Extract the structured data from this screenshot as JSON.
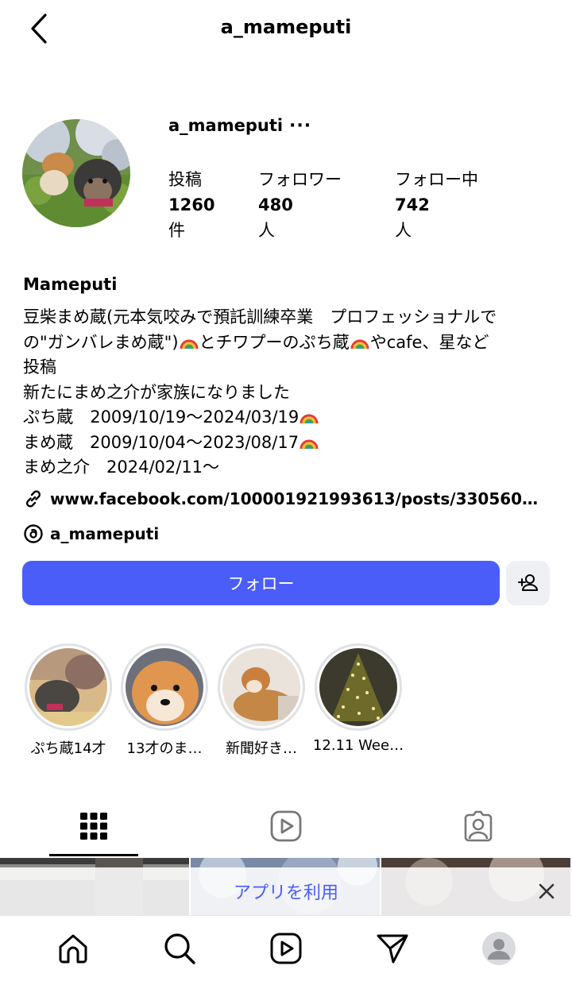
{
  "header": {
    "title": "a_mameputi"
  },
  "profile": {
    "username": "a_mameputi",
    "more_label": "···",
    "stats": [
      {
        "label": "投稿",
        "value": "1260",
        "unit": "件"
      },
      {
        "label": "フォロワー",
        "value": "480",
        "unit": "人"
      },
      {
        "label": "フォロー中",
        "value": "742",
        "unit": "人"
      }
    ],
    "display_name": "Mameputi",
    "bio": {
      "line1": "豆柴まめ蔵(元本気咬みで預託訓練卒業　プロフェッショナルで",
      "line2a": "の\"ガンバレまめ蔵\")",
      "line2b": "とチワプーのぷち蔵",
      "line2c": "やcafe、星など",
      "line3": "投稿",
      "line4": "新たにまめ之介が家族になりました",
      "line5": "ぷち蔵　2009/10/19～2024/03/19",
      "line6": "まめ蔵　2009/10/04～2023/08/17",
      "line7": "まめ之介　2024/02/11～"
    },
    "link": "www.facebook.com/100001921993613/posts/330560…",
    "threads": "a_mameputi",
    "follow_label": "フォロー"
  },
  "highlights": [
    {
      "caption": "ぷち蔵14才"
    },
    {
      "caption": "13才のま…"
    },
    {
      "caption": "新聞好き…"
    },
    {
      "caption": "12.11 Wee…"
    }
  ],
  "tabs": [
    "grid-icon",
    "reels-icon",
    "tagged-icon"
  ],
  "app_banner": {
    "label": "アプリを利用"
  },
  "bottom_nav": [
    "home-icon",
    "search-icon",
    "reels-icon",
    "direct-icon",
    "profile-icon"
  ],
  "colors": {
    "accent": "#4a5df9",
    "secondary_button": "#eff0f3"
  }
}
